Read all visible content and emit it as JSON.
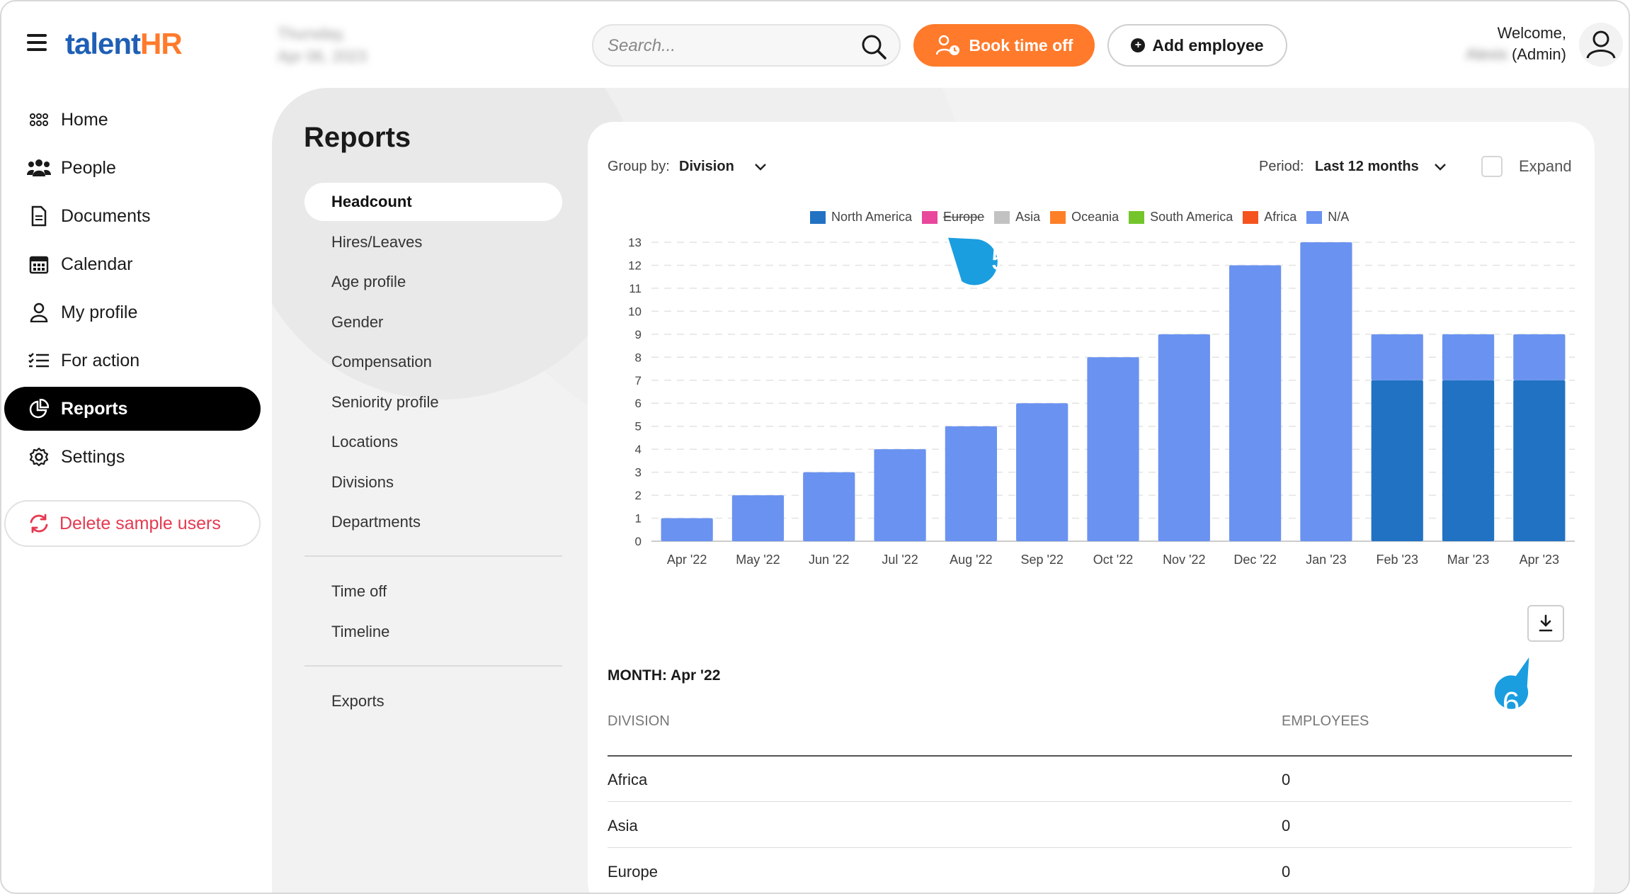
{
  "header": {
    "logo_part1": "talent",
    "logo_part2": "HR",
    "date_line1": "Thursday,",
    "date_line2": "Apr 06, 2023",
    "search_placeholder": "Search...",
    "book_label": "Book time off",
    "add_label": "Add employee",
    "welcome_line1": "Welcome,",
    "user_name": "Alexis",
    "user_role": "(Admin)"
  },
  "nav": {
    "items": [
      {
        "label": "Home",
        "icon": "grid-icon"
      },
      {
        "label": "People",
        "icon": "people-icon"
      },
      {
        "label": "Documents",
        "icon": "document-icon"
      },
      {
        "label": "Calendar",
        "icon": "calendar-icon"
      },
      {
        "label": "My profile",
        "icon": "user-icon"
      },
      {
        "label": "For action",
        "icon": "checklist-icon"
      },
      {
        "label": "Reports",
        "icon": "pie-chart-icon"
      },
      {
        "label": "Settings",
        "icon": "gear-icon"
      }
    ],
    "delete_label": "Delete sample users"
  },
  "reports": {
    "title": "Reports",
    "menu_group1": [
      "Headcount",
      "Hires/Leaves",
      "Age profile",
      "Gender",
      "Compensation",
      "Seniority profile",
      "Locations",
      "Divisions",
      "Departments"
    ],
    "menu_group2": [
      "Time off",
      "Timeline"
    ],
    "menu_group3": [
      "Exports"
    ]
  },
  "controls": {
    "group_by_label": "Group by:",
    "group_by_value": "Division",
    "period_label": "Period:",
    "period_value": "Last 12 months",
    "expand_label": "Expand"
  },
  "chart_data": {
    "type": "bar",
    "stacked": true,
    "categories": [
      "Apr '22",
      "May '22",
      "Jun '22",
      "Jul '22",
      "Aug '22",
      "Sep '22",
      "Oct '22",
      "Nov '22",
      "Dec '22",
      "Jan '23",
      "Feb '23",
      "Mar '23",
      "Apr '23"
    ],
    "series": [
      {
        "name": "North America",
        "color": "#2272c3",
        "values": [
          0,
          0,
          0,
          0,
          0,
          0,
          0,
          0,
          0,
          0,
          7,
          7,
          7
        ]
      },
      {
        "name": "Europe",
        "color": "#e8479c",
        "hidden": true,
        "values": [
          0,
          0,
          0,
          0,
          0,
          0,
          0,
          0,
          0,
          0,
          0,
          0,
          0
        ]
      },
      {
        "name": "Asia",
        "color": "#c2c2c2",
        "values": [
          0,
          0,
          0,
          0,
          0,
          0,
          0,
          0,
          0,
          0,
          0,
          0,
          0
        ]
      },
      {
        "name": "Oceania",
        "color": "#ff7f27",
        "values": [
          0,
          0,
          0,
          0,
          0,
          0,
          0,
          0,
          0,
          0,
          0,
          0,
          0
        ]
      },
      {
        "name": "South America",
        "color": "#74c52c",
        "values": [
          0,
          0,
          0,
          0,
          0,
          0,
          0,
          0,
          0,
          0,
          0,
          0,
          0
        ]
      },
      {
        "name": "Africa",
        "color": "#f5541f",
        "values": [
          0,
          0,
          0,
          0,
          0,
          0,
          0,
          0,
          0,
          0,
          0,
          0,
          0
        ]
      },
      {
        "name": "N/A",
        "color": "#6a92f0",
        "values": [
          1,
          2,
          3,
          4,
          5,
          6,
          8,
          9,
          12,
          13,
          2,
          2,
          2
        ]
      }
    ],
    "ylim": [
      0,
      13
    ],
    "yticks": [
      0,
      1,
      2,
      3,
      4,
      5,
      6,
      7,
      8,
      9,
      10,
      11,
      12,
      13
    ],
    "grid": true,
    "legend_position": "top-center"
  },
  "table": {
    "month_label": "MONTH: Apr '22",
    "col_division": "DIVISION",
    "col_employees": "EMPLOYEES",
    "rows": [
      {
        "division": "Africa",
        "employees": "0"
      },
      {
        "division": "Asia",
        "employees": "0"
      },
      {
        "division": "Europe",
        "employees": "0"
      }
    ]
  },
  "callouts": {
    "five": "5",
    "six": "6",
    "color": "#1a9ee0"
  }
}
